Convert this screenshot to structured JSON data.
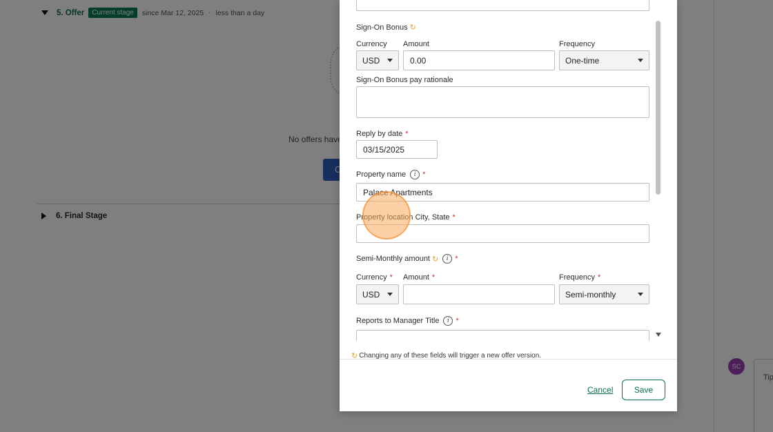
{
  "background": {
    "stage_offer": {
      "title": "5. Offer",
      "badge": "Current stage",
      "since": "since Mar 12, 2025",
      "separator": "·",
      "duration": "less than a day"
    },
    "no_offers_text": "No offers have",
    "create_button_label": "C",
    "stage_final": {
      "title": "6. Final Stage"
    },
    "avatar_initials": "SC",
    "tip_text": "Tip"
  },
  "modal": {
    "sign_on_bonus": {
      "label": "Sign-On Bonus",
      "currency_label": "Currency",
      "currency_value": "USD",
      "amount_label": "Amount",
      "amount_value": "0.00",
      "frequency_label": "Frequency",
      "frequency_value": "One-time"
    },
    "sign_on_rationale": {
      "label": "Sign-On Bonus pay rationale",
      "value": ""
    },
    "reply_by": {
      "label": "Reply by date",
      "value": "03/15/2025"
    },
    "property_name": {
      "label": "Property name",
      "value": "Palace Apartments"
    },
    "property_location": {
      "label": "Property location City, State",
      "value": ""
    },
    "semi_monthly": {
      "label": "Semi-Monthly amount",
      "currency_label": "Currency",
      "currency_value": "USD",
      "amount_label": "Amount",
      "amount_value": "",
      "frequency_label": "Frequency",
      "frequency_value": "Semi-monthly"
    },
    "reports_to": {
      "label": "Reports to Manager Title",
      "value": ""
    },
    "required_mark": "*",
    "sync_icon": "↻",
    "info_icon": "i",
    "footer_note": "Changing any of these fields will trigger a new offer version.",
    "cancel_label": "Cancel",
    "save_label": "Save"
  }
}
